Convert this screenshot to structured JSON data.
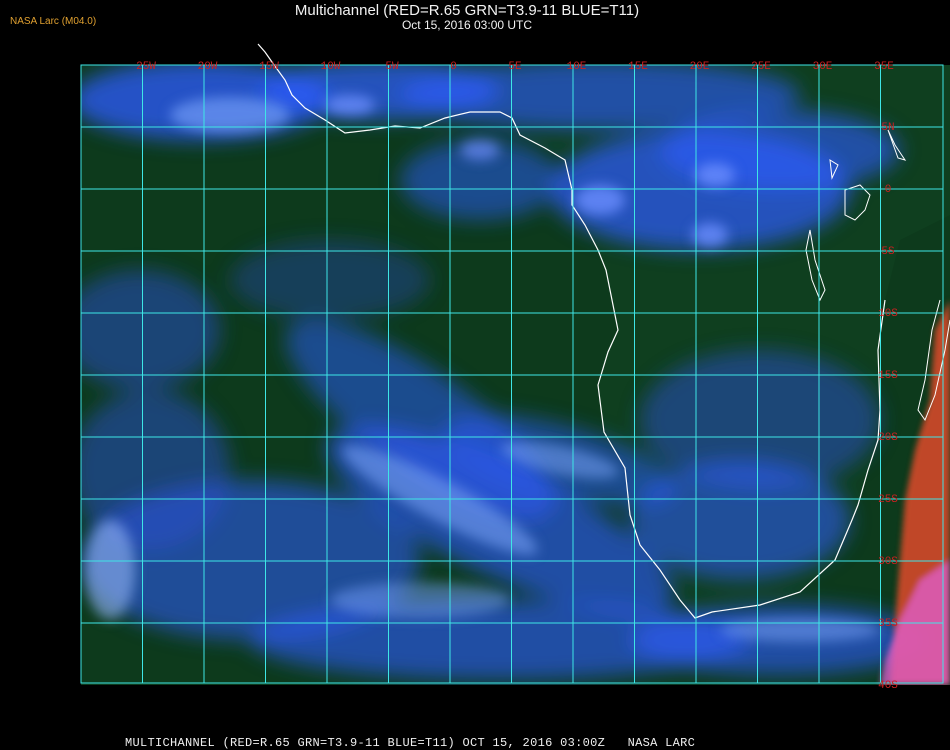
{
  "header": {
    "brand": "NASA Larc (M04.0)",
    "title": "Multichannel (RED=R.65 GRN=T3.9-11 BLUE=T11)",
    "subtitle": "Oct 15, 2016 03:00 UTC"
  },
  "map": {
    "colors": {
      "ocean": "#0d3a1c",
      "cloud_blue": "#2e5cff",
      "cloud_light": "#7fa8ff",
      "grid": "#3ee6e6",
      "coast": "#ffffff",
      "label": "#cc2020",
      "land_hot": "#e04a2a",
      "land_pink": "#e060d0"
    },
    "lon_labels": [
      "25W",
      "20W",
      "15W",
      "10W",
      "5W",
      "0",
      "5E",
      "10E",
      "15E",
      "20E",
      "25E",
      "30E",
      "35E"
    ],
    "lat_labels": [
      "5N",
      "0",
      "5S",
      "10S",
      "15S",
      "20S",
      "25S",
      "30S",
      "35S",
      "40S"
    ]
  },
  "footer": {
    "text": "MULTICHANNEL (RED=R.65 GRN=T3.9-11 BLUE=T11) OCT 15, 2016 03:00Z   NASA LARC"
  }
}
